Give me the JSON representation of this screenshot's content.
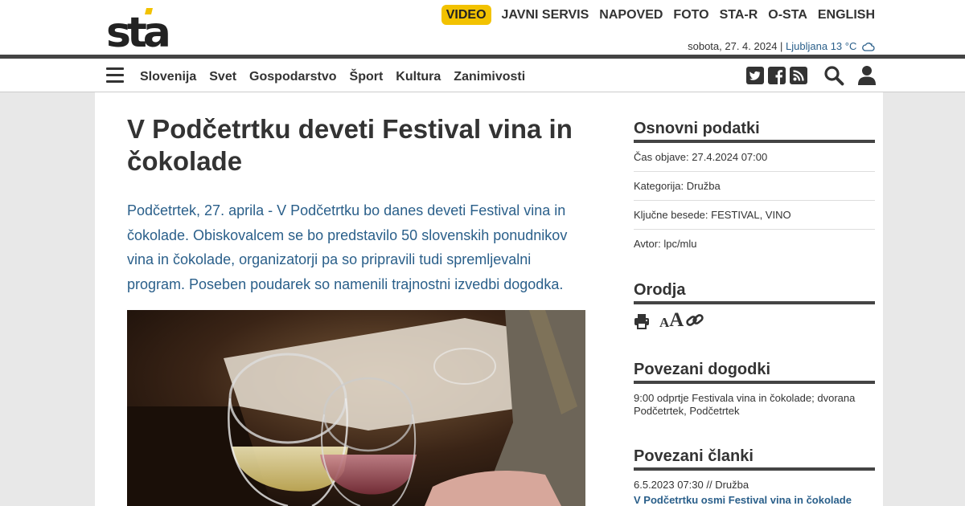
{
  "header": {
    "logo_text": "sta",
    "top_links": [
      "VIDEO",
      "JAVNI SERVIS",
      "NAPOVED",
      "FOTO",
      "STA-R",
      "O-STA",
      "ENGLISH"
    ],
    "date": "sobota, 27. 4. 2024 |",
    "weather": "Ljubljana 13 °C",
    "weather_icon": "cloud-icon",
    "accent_color": "#f2c200"
  },
  "nav": {
    "items": [
      "Slovenija",
      "Svet",
      "Gospodarstvo",
      "Šport",
      "Kultura",
      "Zanimivosti"
    ],
    "icons": [
      "twitter-icon",
      "facebook-icon",
      "rss-icon",
      "search-icon",
      "user-icon"
    ]
  },
  "article": {
    "title": "V Podčetrtku deveti Festival vina in čokolade",
    "lead": "Podčetrtek, 27. aprila - V Podčetrtku bo danes deveti Festival vina in čokolade. Obiskovalcem se bo predstavilo 50 slovenskih ponudnikov vina in čokolade, organizatorji pa so pripravili tudi spremljevalni program. Poseben poudarek so namenili trajnostni izvedbi dogodka.",
    "lead_color": "#2a5f8a"
  },
  "sidebar": {
    "basic_title": "Osnovni podatki",
    "basic_rows": [
      "Čas objave: 27.4.2024 07:00",
      "Kategorija: Družba",
      "Ključne besede: FESTIVAL, VINO",
      "Avtor: lpc/mlu"
    ],
    "tools_title": "Orodja",
    "tools_small": "A",
    "tools_big": "A",
    "events_title": "Povezani dogodki",
    "event_text": "9:00 odprtje Festivala vina in čokolade; dvorana Podčetrtek, Podčetrtek",
    "articles_title": "Povezani članki",
    "article_meta": "6.5.2023 07:30 // Družba",
    "article_link": "V Podčetrtku osmi Festival vina in čokolade"
  }
}
